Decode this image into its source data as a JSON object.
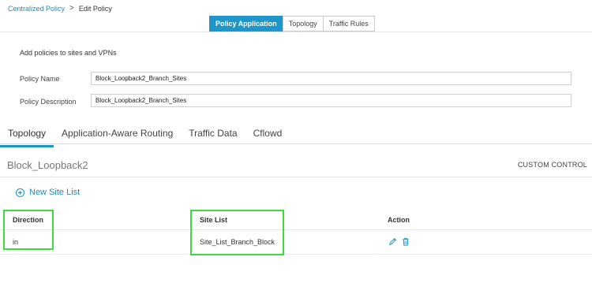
{
  "breadcrumb": {
    "parent": "Centralized Policy",
    "separator": ">",
    "current": "Edit Policy"
  },
  "top_tabs": [
    {
      "label": "Policy Application",
      "active": true
    },
    {
      "label": "Topology",
      "active": false
    },
    {
      "label": "Traffic Rules",
      "active": false
    }
  ],
  "intro": "Add policies to sites and VPNs",
  "form": {
    "name_label": "Policy Name",
    "name_value": "Block_Loopback2_Branch_Sites",
    "desc_label": "Policy Description",
    "desc_value": "Block_Loopback2_Branch_Sites"
  },
  "sub_tabs": [
    {
      "label": "Topology",
      "active": true
    },
    {
      "label": "Application-Aware Routing",
      "active": false
    },
    {
      "label": "Traffic Data",
      "active": false
    },
    {
      "label": "Cflowd",
      "active": false
    }
  ],
  "section": {
    "title": "Block_Loopback2",
    "custom_control": "CUSTOM CONTROL"
  },
  "new_site_list": "New Site List",
  "table": {
    "headers": {
      "direction": "Direction",
      "site_list": "Site List",
      "action": "Action"
    },
    "rows": [
      {
        "direction": "in",
        "site_list": "Site_List_Branch_Block"
      }
    ]
  },
  "icons": {
    "edit": "pencil-icon",
    "delete": "trash-icon",
    "add": "plus-circle-icon"
  },
  "colors": {
    "accent": "#1d97c9",
    "highlight": "#3bdc3b"
  }
}
